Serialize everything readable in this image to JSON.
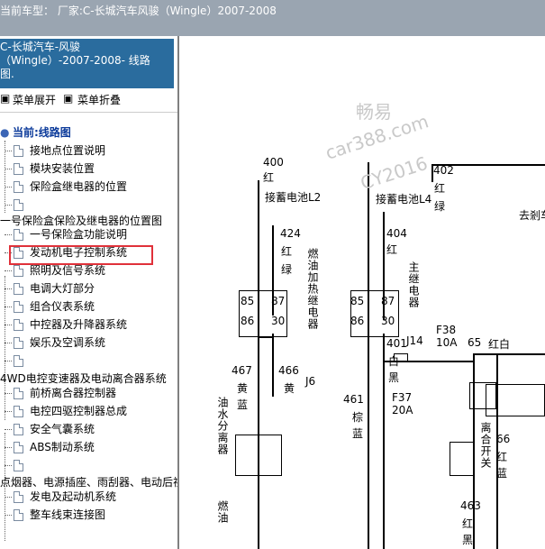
{
  "header": {
    "title": "当前车型： 厂家:C-长城汽车风骏（Wingle）2007-2008"
  },
  "sidebar": {
    "heading_lines": [
      "C-长城汽车-风骏",
      "（Wingle）-2007-2008- 线路",
      "图."
    ],
    "expand_label": "菜单展开",
    "collapse_label": "菜单折叠",
    "current_label": "当前:线路图",
    "items": [
      "接地点位置说明",
      "模块安装位置",
      "保险盒继电器的位置",
      "",
      "一号保险盒保险及继电器的位置图",
      "一号保险盒功能说明",
      "发动机电子控制系统",
      "照明及信号系统",
      "电调大灯部分",
      "组合仪表系统",
      "中控器及升降器系统",
      "娱乐及空调系统",
      "",
      "4WD电控变速器及电动离合器系统",
      "前桥离合器控制器",
      "电控四驱控制器总成",
      "安全气囊系统",
      "ABS制动系统",
      "",
      "点烟器、电源插座、雨刮器、电动后视镜",
      "发电及起动机系统",
      "整车线束连接图"
    ]
  },
  "diagram": {
    "w400": "400",
    "w400c": "红",
    "l2": "接蓄电池L2",
    "w424": "424",
    "w424c": "红",
    "w424c2": "绿",
    "w404": "404",
    "w404c": "红",
    "l4": "接蓄电池L4",
    "w402": "402",
    "w402c": "红",
    "w402c2": "绿",
    "remote": "去剎车",
    "r1_85": "85",
    "r1_86": "86",
    "r1_87": "87",
    "r1_30": "30",
    "r2_85": "85",
    "r2_86": "86",
    "r2_87": "87",
    "r2_30": "30",
    "fuel_relay": "燃油加热继电器",
    "j6": "J6",
    "main_relay": "主继电器",
    "j14": "J14",
    "f38": "F38",
    "f38a": "10A",
    "w65": "65",
    "w65c": "红白",
    "w401": "401",
    "w401c": "白",
    "w401c2": "黑",
    "w467": "467",
    "w467c": "黄",
    "w467c2": "蓝",
    "w466": "466",
    "w466c": "黄",
    "w461": "461",
    "w461c": "棕",
    "w461c2": "蓝",
    "f37": "F37",
    "f37a": "20A",
    "oil_sep": "油水分离器",
    "fuel": "燃油",
    "clutch": "离合开关",
    "w66": "66",
    "w66c": "红",
    "w66c2": "蓝",
    "w463": "463",
    "w463c": "红",
    "w463c2": "黑",
    "wm1": "畅易",
    "wm2": "car388.com",
    "wm3": "CY2016"
  }
}
